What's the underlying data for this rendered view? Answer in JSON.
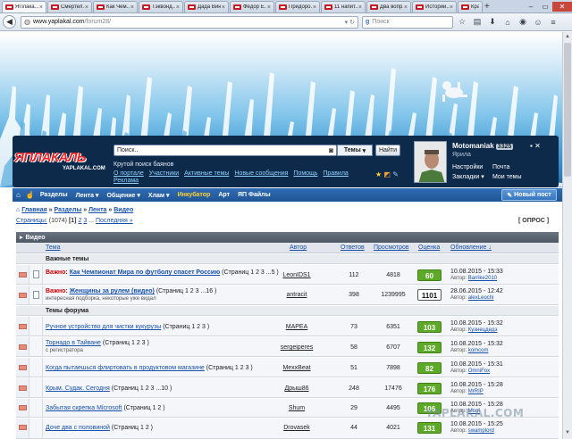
{
  "browser": {
    "tabs": [
      {
        "label": "ЯПлака..."
      },
      {
        "label": "Смертел..."
      },
      {
        "label": "Как Чем..."
      },
      {
        "label": "Тэквонд..."
      },
      {
        "label": "Дада Вин..."
      },
      {
        "label": "Фёдор Е..."
      },
      {
        "label": "Придоро..."
      },
      {
        "label": "11 напит..."
      },
      {
        "label": "Два вопр..."
      },
      {
        "label": "Истории..."
      },
      {
        "label": "Кра..."
      }
    ],
    "url_domain": "www.yaplakal.com",
    "url_path": "/forum28/",
    "search_placeholder": "Поиск",
    "search_engine": "g"
  },
  "header": {
    "logo_main": "ЯПЛАКАЛЬ",
    "logo_sub": "YAPLAKAL.COM",
    "search_value": "Поиск..",
    "search_select": "Темы",
    "search_button": "Найти",
    "search_hint": "Крутой поиск баянов",
    "links": [
      "О портале",
      "Участники",
      "Активные темы",
      "Новые сообщения",
      "Помощь",
      "Правила"
    ],
    "ad_link": "Реклама"
  },
  "user": {
    "name": "Motomaniak",
    "count": "3325",
    "city": "Ярила",
    "menu_left": [
      "Настройки",
      "Закладки"
    ],
    "menu_right": [
      "Почта",
      "Мои темы"
    ]
  },
  "mainnav": {
    "items": [
      "Разделы",
      "Лента",
      "Общение",
      "Хлам",
      "Инкубатор",
      "Арт",
      "ЯП Файлы"
    ],
    "new_post": "Новый пост"
  },
  "breadcrumb": [
    "Главная",
    "Разделы",
    "Лента",
    "Видео"
  ],
  "pager": {
    "label": "Страницы:",
    "total": "(1074)",
    "current": "[1]",
    "pages": [
      "2",
      "3"
    ],
    "last": "Последняя »"
  },
  "opros": "[ ОПРОС ]",
  "forum": {
    "title": "Видео",
    "columns": {
      "topic": "Тема",
      "author": "Автор",
      "answers": "Ответов",
      "views": "Просмотров",
      "rating": "Оценка",
      "updated": "Обновление ↓"
    },
    "sections": {
      "important": "Важные темы",
      "topics": "Темы форума"
    },
    "important": [
      {
        "prefix": "Важно:",
        "title": "Как Чемпионат Мира по футболу спасет Россию",
        "pages": "(Страниц 1 2 3 ...5 )",
        "author": "LeonIDS1",
        "answers": "112",
        "views": "4818",
        "rating": "60",
        "date": "10.08.2015 - 15:33",
        "last_prefix": "Автор:",
        "last": "Barrike2010",
        "sub": ""
      },
      {
        "prefix": "Важно:",
        "title": "Женщины за рулем (видео)",
        "pages": "(Страниц 1 2 3 ...16 )",
        "author": "antracit",
        "answers": "398",
        "views": "1239995",
        "rating": "1101",
        "date": "28.06.2015 - 12:42",
        "last_prefix": "Автор:",
        "last": "alexLeochi",
        "sub": "интересная подборка, некоторые уже видал"
      }
    ],
    "topics": [
      {
        "title": "Ручное устройство для чистки кукурузы",
        "pages": "(Страниц 1 2 3 )",
        "author": "MAPEA",
        "answers": "73",
        "views": "6351",
        "rating": "103",
        "date": "10.08.2015 - 15:32",
        "last_prefix": "Автор:",
        "last": "Кузнецдедэ",
        "sub": ""
      },
      {
        "title": "Торнадо в Тайване",
        "pages": "(Страниц 1 2 3 )",
        "author": "sergeiperes",
        "answers": "58",
        "views": "6707",
        "rating": "132",
        "date": "10.08.2015 - 15:32",
        "last_prefix": "Автор:",
        "last": "komcom",
        "sub": "с регистратора"
      },
      {
        "title": "Когда пытаешься флиртовать в продуктовом магазине",
        "pages": "(Страниц 1 2 3 )",
        "author": "MexxBeat",
        "answers": "51",
        "views": "7898",
        "rating": "82",
        "date": "10.08.2015 - 15:31",
        "last_prefix": "Автор:",
        "last": "OmniFox",
        "sub": ""
      },
      {
        "title": "Крым. Судак. Сегодня",
        "pages": "(Страниц 1 2 3 ...10 )",
        "author": "Дрыш86",
        "answers": "248",
        "views": "17476",
        "rating": "176",
        "date": "10.08.2015 - 15:28",
        "last_prefix": "Автор:",
        "last": "MrRIP",
        "sub": ""
      },
      {
        "title": "Забытая скрепка Microsoft",
        "pages": "(Страниц 1 2 )",
        "author": "Shum",
        "answers": "29",
        "views": "4495",
        "rating": "106",
        "date": "10.08.2015 - 15:28",
        "last_prefix": "Автор:",
        "last": "Moni",
        "sub": ""
      },
      {
        "title": "Доче два с половиной",
        "pages": "(Страниц 1 2 )",
        "author": "Drovasek",
        "answers": "44",
        "views": "4021",
        "rating": "131",
        "date": "10.08.2015 - 15:25",
        "last_prefix": "Автор:",
        "last": "swamplord",
        "sub": ""
      }
    ]
  },
  "watermark": "YAPLAKAL.COM",
  "colors": {
    "accent": "#205594",
    "rating_green": "#5fa92a",
    "important_red": "#cc0000",
    "header_dark": "#0e2a4a"
  }
}
